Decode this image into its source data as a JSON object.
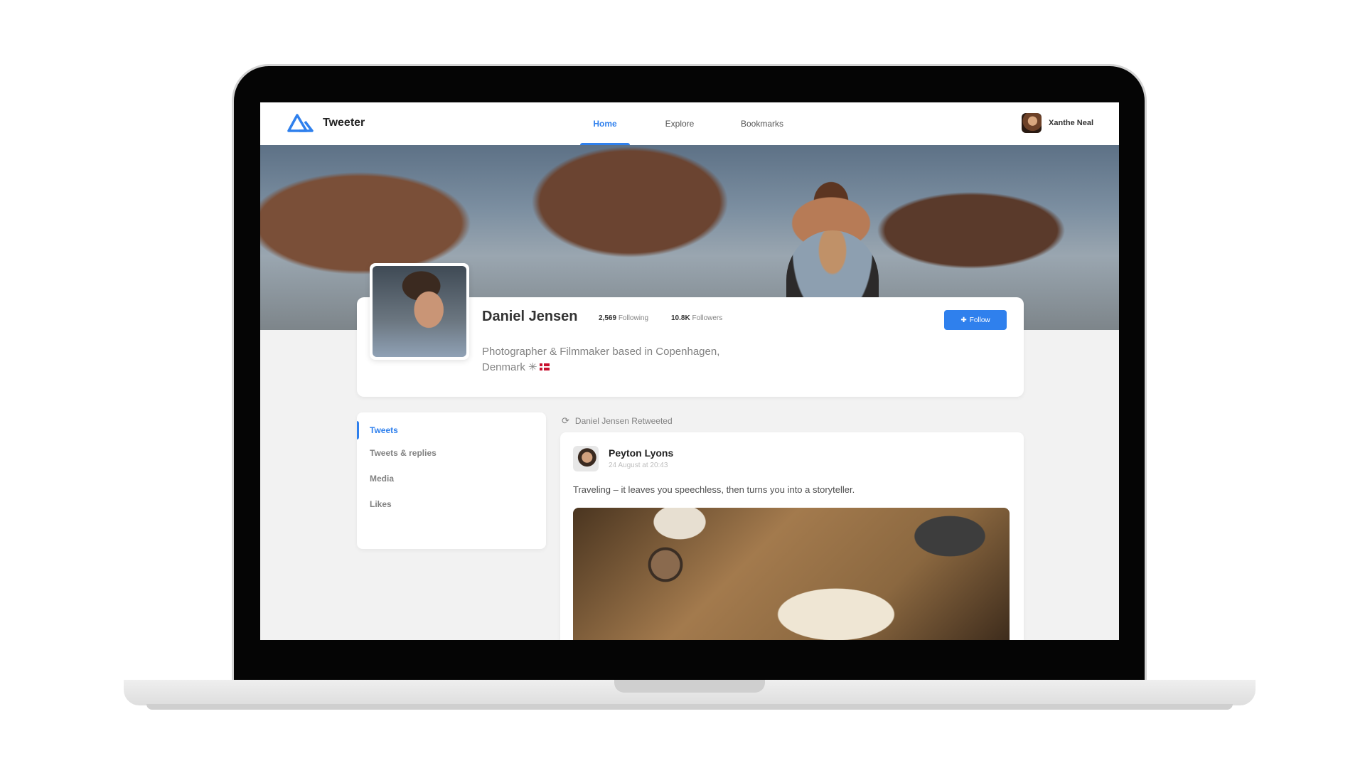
{
  "app": {
    "name": "Tweeter",
    "accent_color": "#2f80ed"
  },
  "nav": {
    "tabs": [
      {
        "label": "Home",
        "active": true
      },
      {
        "label": "Explore",
        "active": false
      },
      {
        "label": "Bookmarks",
        "active": false
      }
    ],
    "user_name": "Xanthe Neal"
  },
  "profile": {
    "name": "Daniel Jensen",
    "following_count": "2,569",
    "following_label": "Following",
    "followers_count": "10.8K",
    "followers_label": "Followers",
    "bio_line1": "Photographer & Filmmaker based in Copenhagen,",
    "bio_line2": "Denmark ✳",
    "follow_label": "Follow"
  },
  "sidebar": {
    "items": [
      {
        "label": "Tweets",
        "active": true
      },
      {
        "label": "Tweets & replies",
        "active": false
      },
      {
        "label": "Media",
        "active": false
      },
      {
        "label": "Likes",
        "active": false
      }
    ]
  },
  "feed": {
    "retweet_label": "Daniel Jensen Retweeted",
    "tweet": {
      "author": "Peyton Lyons",
      "timestamp": "24 August at 20:43",
      "text": "Traveling – it leaves you speechless, then turns you into a storyteller."
    }
  }
}
